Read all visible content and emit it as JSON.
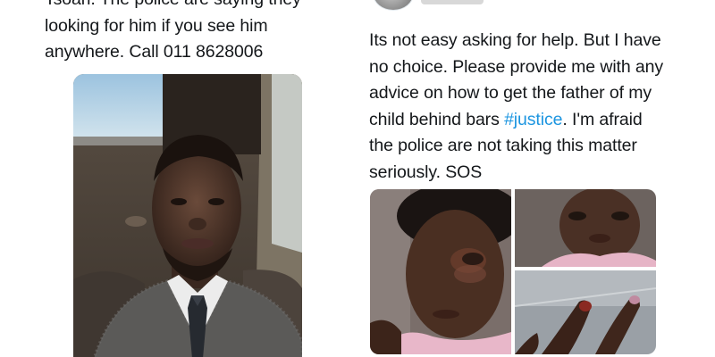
{
  "left_tweet": {
    "text_lines": [
      "Tsoari. The police are saying they",
      "looking for him if you see him",
      "anywhere. Call 011 8628006"
    ]
  },
  "right_tweet": {
    "text_lines": [
      "Its not easy asking for help. But I have",
      "no choice. Please provide me with any",
      "advice on how to get the father of my"
    ],
    "line4_before": "child behind bars ",
    "hashtag": "#justice",
    "line4_after": ". I'm afraid",
    "text_lines_end": [
      "the police are not taking this matter",
      "seriously. SOS"
    ]
  },
  "colors": {
    "text": "#14171a",
    "hashtag": "#1b95e0",
    "background": "#ffffff"
  }
}
